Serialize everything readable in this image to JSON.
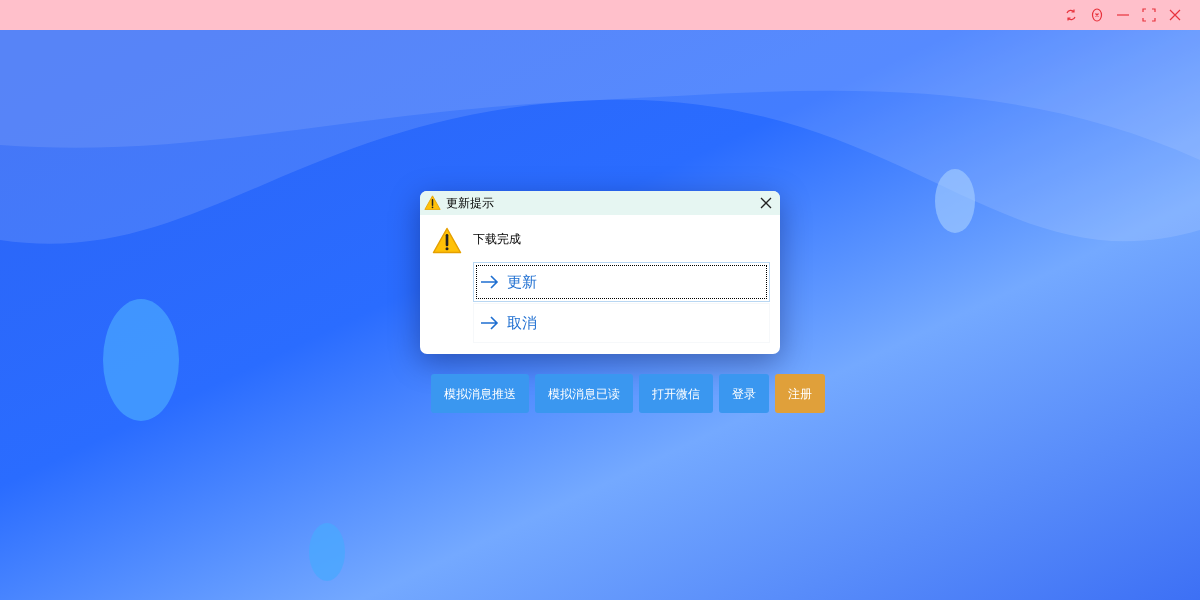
{
  "title_bar": {
    "buttons": [
      {
        "kind": "refresh"
      },
      {
        "kind": "close-circle"
      },
      {
        "kind": "minimize"
      },
      {
        "kind": "maximize"
      },
      {
        "kind": "close"
      }
    ]
  },
  "dialog": {
    "title": "更新提示",
    "message": "下载完成",
    "options": [
      {
        "label": "更新",
        "selected": true
      },
      {
        "label": "取消",
        "selected": false
      }
    ]
  },
  "buttons": [
    {
      "label": "模拟消息推送",
      "color": "#3a97f0"
    },
    {
      "label": "模拟消息已读",
      "color": "#3a97f0"
    },
    {
      "label": "打开微信",
      "color": "#3a97f0"
    },
    {
      "label": "登录",
      "color": "#3a97f0"
    },
    {
      "label": "注册",
      "color": "#e0a03a"
    }
  ]
}
